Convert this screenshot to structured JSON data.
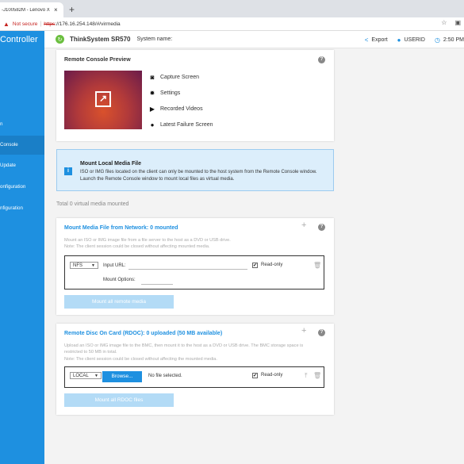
{
  "browser": {
    "tab_title": "-J100582M - Lenovo X",
    "tab_close": "×",
    "new_tab": "+",
    "warning_icon": "warning-icon",
    "not_secure": "Not secure",
    "separator": "|",
    "url_scheme": "https",
    "url_rest": "://176.16.254.148/#/virmedia"
  },
  "sidebar": {
    "title": "Controller",
    "items": [
      {
        "label": "n"
      },
      {
        "label": "Console"
      },
      {
        "label": "Update"
      },
      {
        "label": "onfiguration"
      },
      {
        "label": "nfiguration"
      }
    ]
  },
  "topbar": {
    "model": "ThinkSystem SR570",
    "system_name_label": "System name:",
    "export_label": "Export",
    "user_label": "USERID",
    "time_label": "2:50 PM"
  },
  "preview": {
    "title": "Remote Console Preview",
    "help": "?",
    "actions": [
      {
        "label": "Capture Screen",
        "icon": "camera-icon"
      },
      {
        "label": "Settings",
        "icon": "gear-icon"
      },
      {
        "label": "Recorded Videos",
        "icon": "play-icon"
      },
      {
        "label": "Latest Failure Screen",
        "icon": "alert-icon"
      }
    ]
  },
  "info": {
    "icon": "i",
    "title": "Mount Local Media File",
    "line1": "ISO or IMG files located on the client can only be mounted to the host system from the Remote Console window.",
    "line2": "Launch the Remote Console window to mount local files as virtual media."
  },
  "total_mounted": "Total 0 virtual media mounted",
  "network": {
    "title": "Mount Media File from Network: 0 mounted",
    "plus": "+",
    "help": "?",
    "desc1": "Mount an ISO or IMG image file from a file server to the host as a DVD or USB drive.",
    "desc2": "Note: The client session could be closed without affecting mounted media.",
    "protocol": "NFS",
    "url_label": "Input URL:",
    "options_label": "Mount Options:",
    "readonly_label": "Read-only",
    "readonly_checked": "✔",
    "mount_all": "Mount all remote media"
  },
  "rdoc": {
    "title": "Remote Disc On Card (RDOC): 0 uploaded (50 MB available)",
    "plus": "+",
    "help": "?",
    "desc1": "Upload an ISO or IMG image file to the BMC, then mount it to the host as a DVD or USB drive. The BMC storage space is",
    "desc2": "restricted to 50 MB in total.",
    "desc3": "Note: The client session could be closed without affecting the mounted media.",
    "source": "LOCAL",
    "browse": "Browse...",
    "no_file": "No file selected.",
    "readonly_label": "Read-only",
    "readonly_checked": "✔",
    "mount_all": "Mount all RDOC files"
  }
}
